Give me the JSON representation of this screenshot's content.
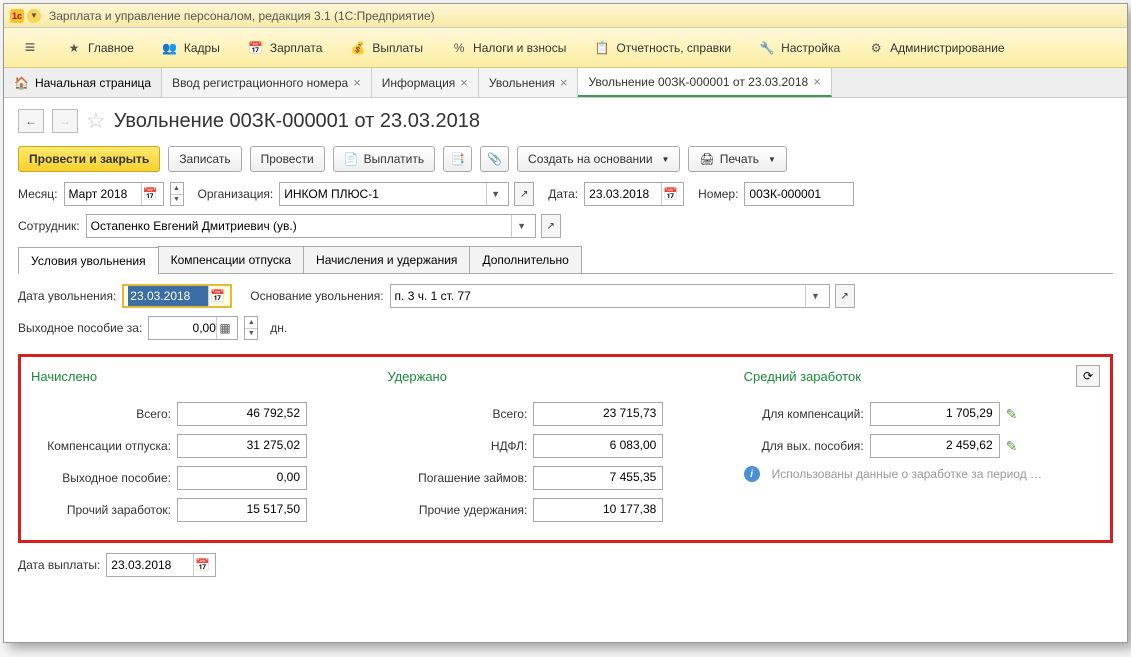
{
  "title": "Зарплата и управление персоналом, редакция 3.1  (1С:Предприятие)",
  "menu": {
    "main": "Главное",
    "kadry": "Кадры",
    "zarplata": "Зарплата",
    "vyplaty": "Выплаты",
    "nalogi": "Налоги и взносы",
    "otchet": "Отчетность, справки",
    "nastroika": "Настройка",
    "admin": "Администрирование"
  },
  "tabs": {
    "home": "Начальная страница",
    "t1": "Ввод регистрационного номера",
    "t2": "Информация",
    "t3": "Увольнения",
    "t4": "Увольнение 00ЗК-000001 от 23.03.2018"
  },
  "header": "Увольнение 00ЗК-000001 от 23.03.2018",
  "toolbar": {
    "process_close": "Провести и закрыть",
    "write": "Записать",
    "process": "Провести",
    "pay": "Выплатить",
    "create_based": "Создать на основании",
    "print": "Печать"
  },
  "form": {
    "month_label": "Месяц:",
    "month_value": "Март 2018",
    "org_label": "Организация:",
    "org_value": "ИНКОМ ПЛЮС-1",
    "date_label": "Дата:",
    "date_value": "23.03.2018",
    "number_label": "Номер:",
    "number_value": "00ЗК-000001",
    "employee_label": "Сотрудник:",
    "employee_value": "Остапенко Евгений Дмитриевич (ув.)"
  },
  "inner_tabs": {
    "t0": "Условия увольнения",
    "t1": "Компенсации отпуска",
    "t2": "Начисления и удержания",
    "t3": "Дополнительно"
  },
  "dismiss": {
    "date_label": "Дата увольнения:",
    "date_value": "23.03.2018",
    "basis_label": "Основание увольнения:",
    "basis_value": "п. 3 ч. 1 ст. 77",
    "severance_label": "Выходное пособие за:",
    "severance_value": "0,00",
    "days": "дн."
  },
  "summary": {
    "accrued_h": "Начислено",
    "accrued": {
      "total_l": "Всего:",
      "total_v": "46 792,52",
      "comp_l": "Компенсации отпуска:",
      "comp_v": "31 275,02",
      "sev_l": "Выходное пособие:",
      "sev_v": "0,00",
      "other_l": "Прочий заработок:",
      "other_v": "15 517,50"
    },
    "withheld_h": "Удержано",
    "withheld": {
      "total_l": "Всего:",
      "total_v": "23 715,73",
      "ndfl_l": "НДФЛ:",
      "ndfl_v": "6 083,00",
      "loan_l": "Погашение займов:",
      "loan_v": "7 455,35",
      "other_l": "Прочие удержания:",
      "other_v": "10 177,38"
    },
    "avg_h": "Средний заработок",
    "avg": {
      "comp_l": "Для компенсаций:",
      "comp_v": "1 705,29",
      "sev_l": "Для вых. пособия:",
      "sev_v": "2 459,62",
      "info": "Использованы данные о заработке за период …"
    }
  },
  "payment": {
    "label": "Дата выплаты:",
    "value": "23.03.2018"
  }
}
